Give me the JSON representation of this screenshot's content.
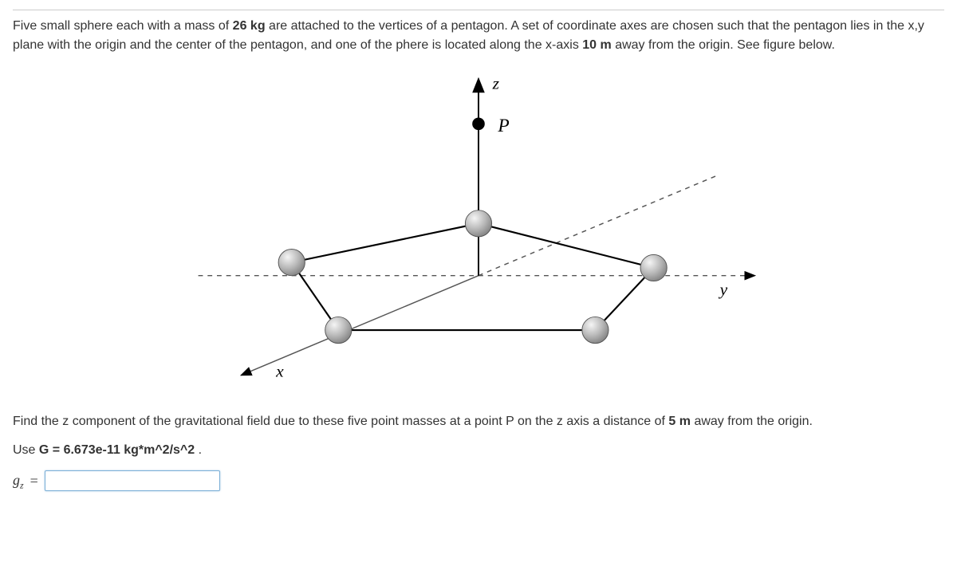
{
  "problem": {
    "intro_pre": "Five small sphere each with a mass of ",
    "mass_value": "26 kg",
    "intro_mid": " are attached to the vertices of a pentagon. A set of coordinate axes are chosen such that the pentagon lies in the x,y plane with the origin and the center of the pentagon, and one of the phere is located along the x-axis ",
    "radius_value": "10 m",
    "intro_post": " away from the origin. See figure below."
  },
  "figure": {
    "axis_z": "z",
    "axis_y": "y",
    "axis_x": "x",
    "point_label": "P"
  },
  "find": {
    "pre": "Find the z component of the gravitational field due to these five point masses at a point P on the z axis a distance of ",
    "distance_value": "5 m",
    "post": " away from the origin."
  },
  "use_line": {
    "pre": "Use ",
    "formula": "G = 6.673e-11 kg*m^2/s^2",
    "post": " ."
  },
  "answer": {
    "symbol": "g",
    "subscript": "z",
    "value": "",
    "placeholder": ""
  }
}
